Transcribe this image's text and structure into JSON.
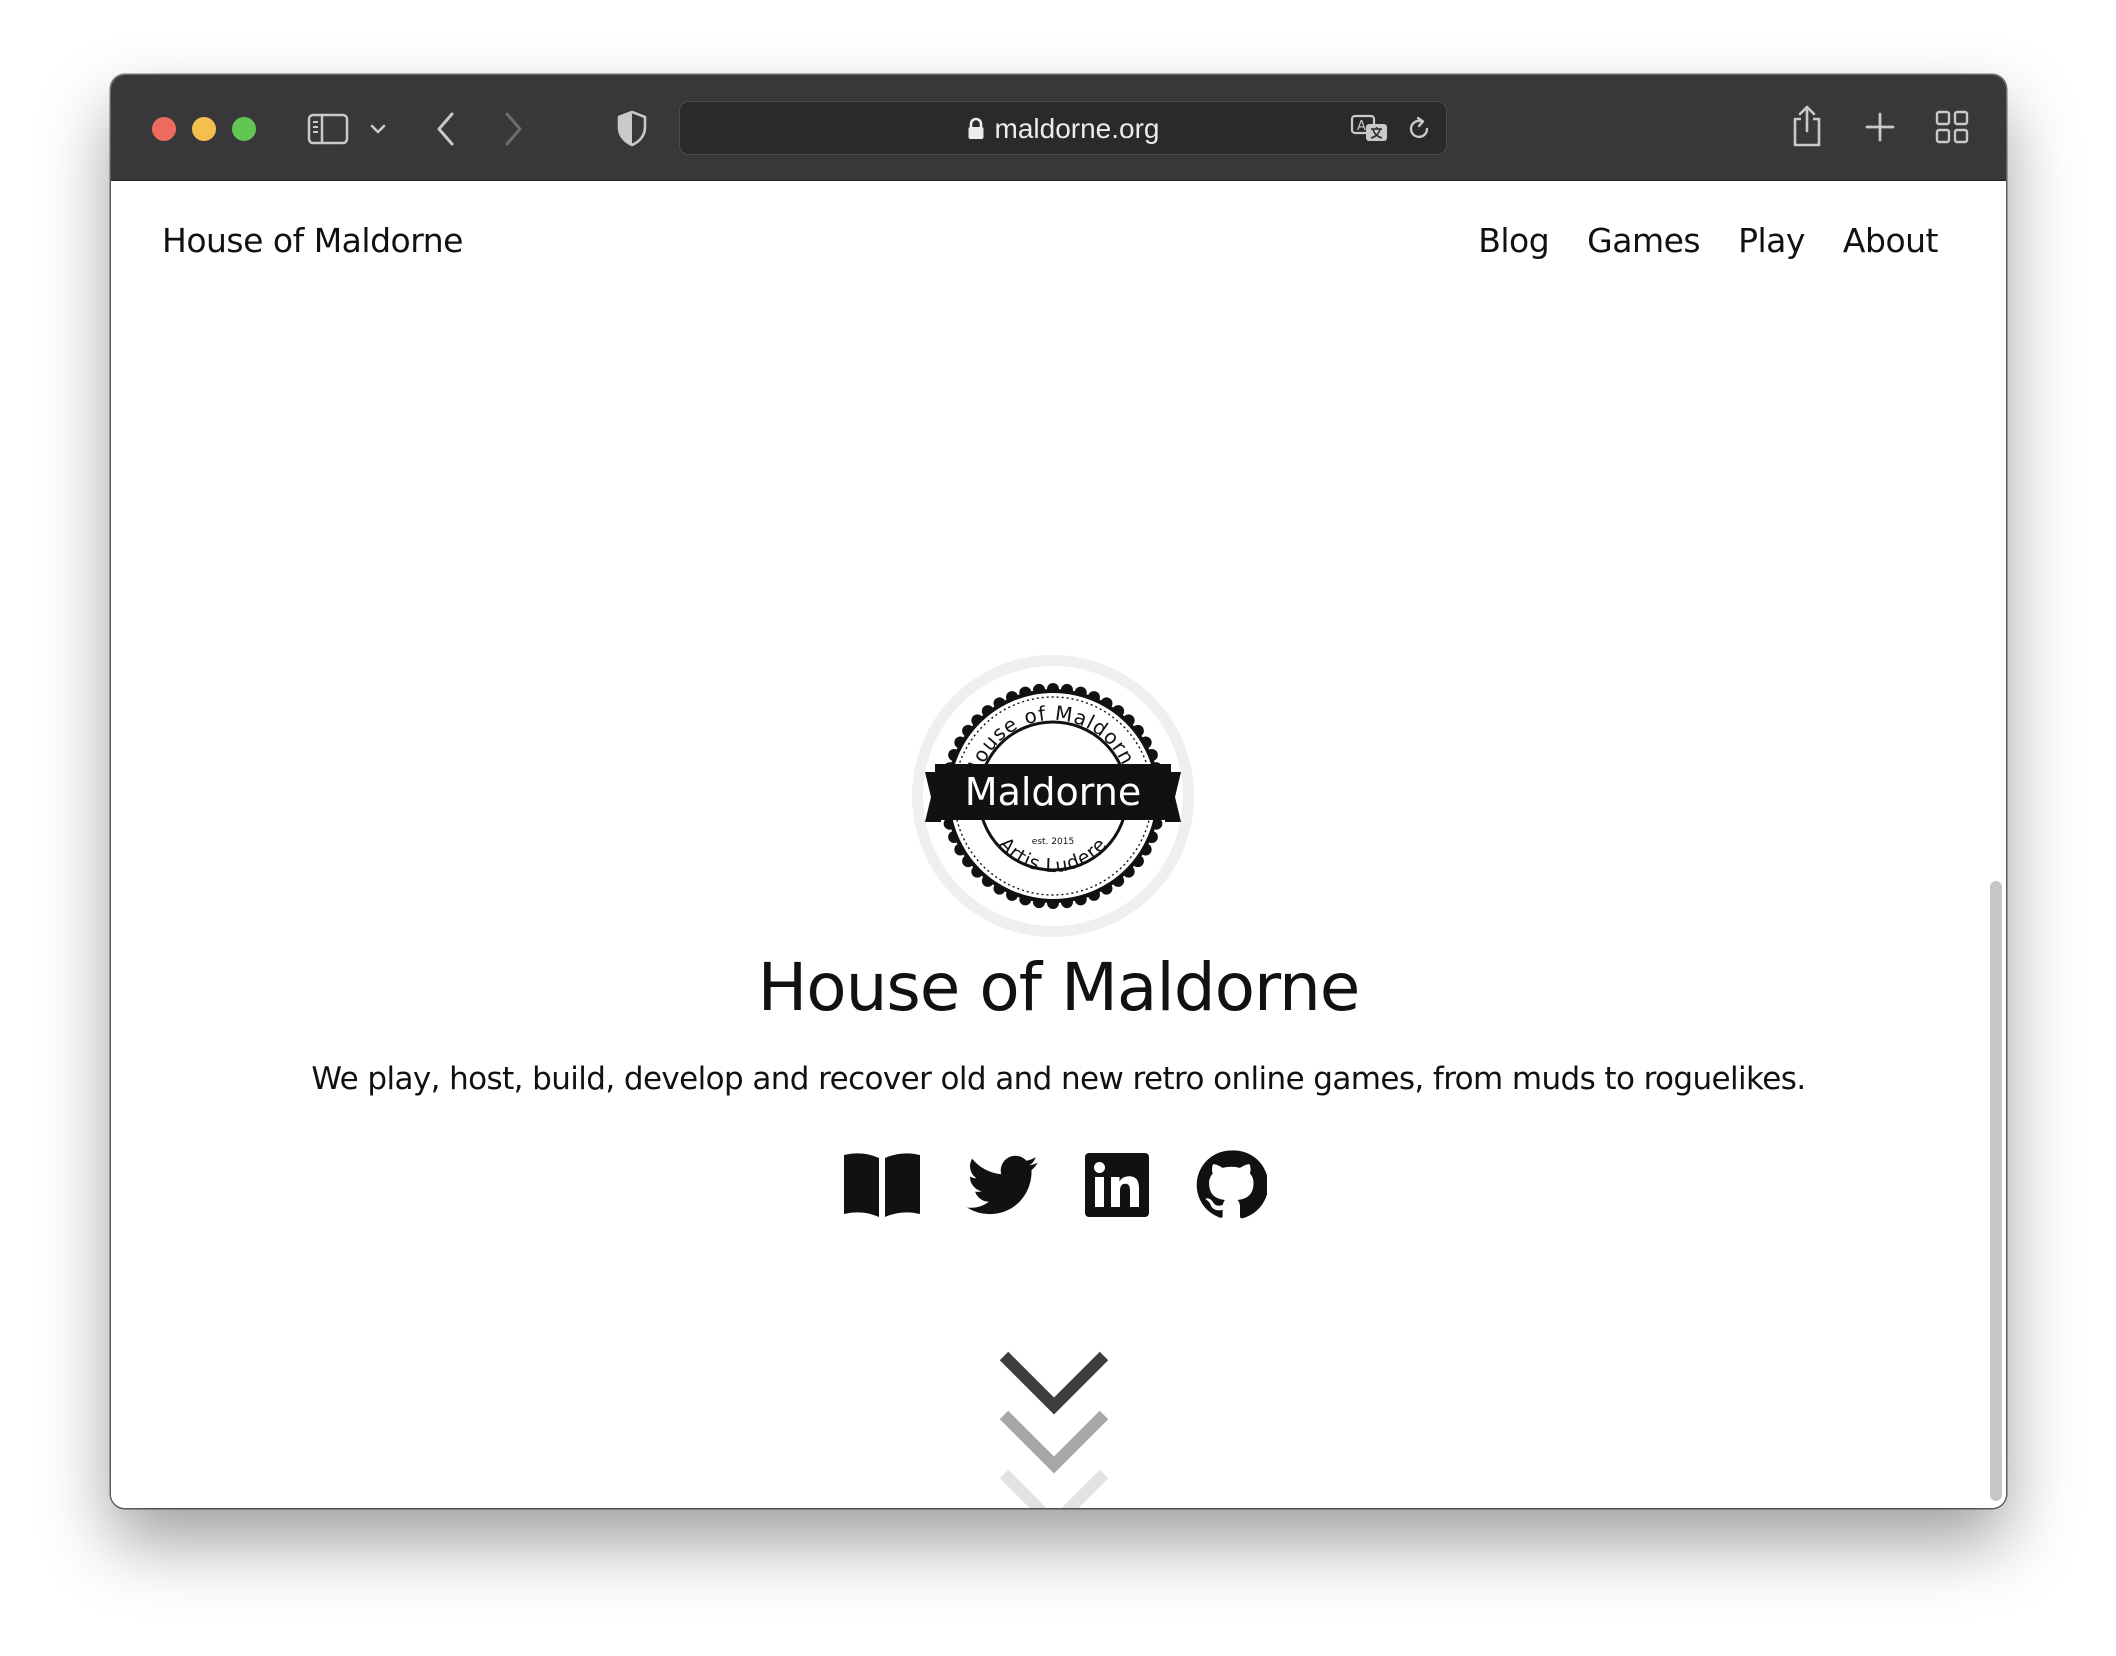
{
  "browser": {
    "url": "maldorne.org",
    "colors": {
      "toolbar": "#38383b",
      "close": "#ed6a5e",
      "minimize": "#f5bf4f",
      "zoom": "#61c554"
    }
  },
  "site": {
    "brand": "House of Maldorne",
    "nav": {
      "blog": "Blog",
      "games": "Games",
      "play": "Play",
      "about": "About"
    }
  },
  "hero": {
    "logo": {
      "arc_top": "House of Maldorne",
      "banner": "Maldorne",
      "established": "est. 2015",
      "arc_bottom": "Artis Ludere"
    },
    "title": "House of Maldorne",
    "subtitle": "We play, host, build, develop and recover old and new retro online games, from muds to roguelikes."
  },
  "social_icons": [
    "book-icon",
    "twitter-icon",
    "linkedin-icon",
    "github-icon"
  ],
  "scroll_hint_icons": [
    "chevron-down-icon",
    "chevron-down-icon",
    "chevron-down-icon"
  ]
}
